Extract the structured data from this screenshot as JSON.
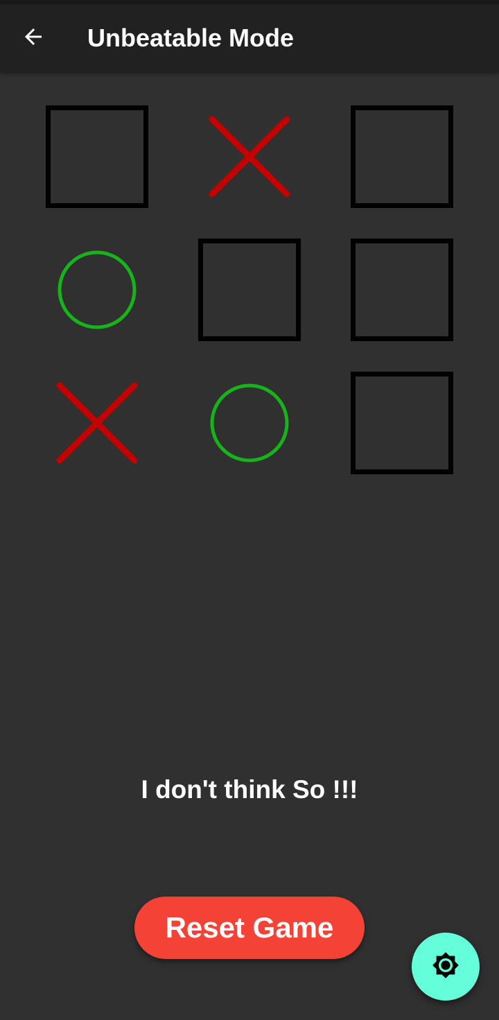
{
  "app_bar": {
    "title": "Unbeatable Mode",
    "back_icon": "arrow-back-icon"
  },
  "board": {
    "rows": [
      [
        "",
        "X",
        ""
      ],
      [
        "O",
        "",
        ""
      ],
      [
        "X",
        "O",
        ""
      ]
    ],
    "colors": {
      "x": "#c40000",
      "o": "#17b31a",
      "empty_border": "#000000"
    }
  },
  "message": "I don't think So !!!",
  "reset_button": {
    "label": "Reset Game",
    "color": "#f44336"
  },
  "fab": {
    "icon": "brightness-icon",
    "color": "#64ffda"
  },
  "theme": {
    "background": "#303030",
    "app_bar": "#212121"
  }
}
